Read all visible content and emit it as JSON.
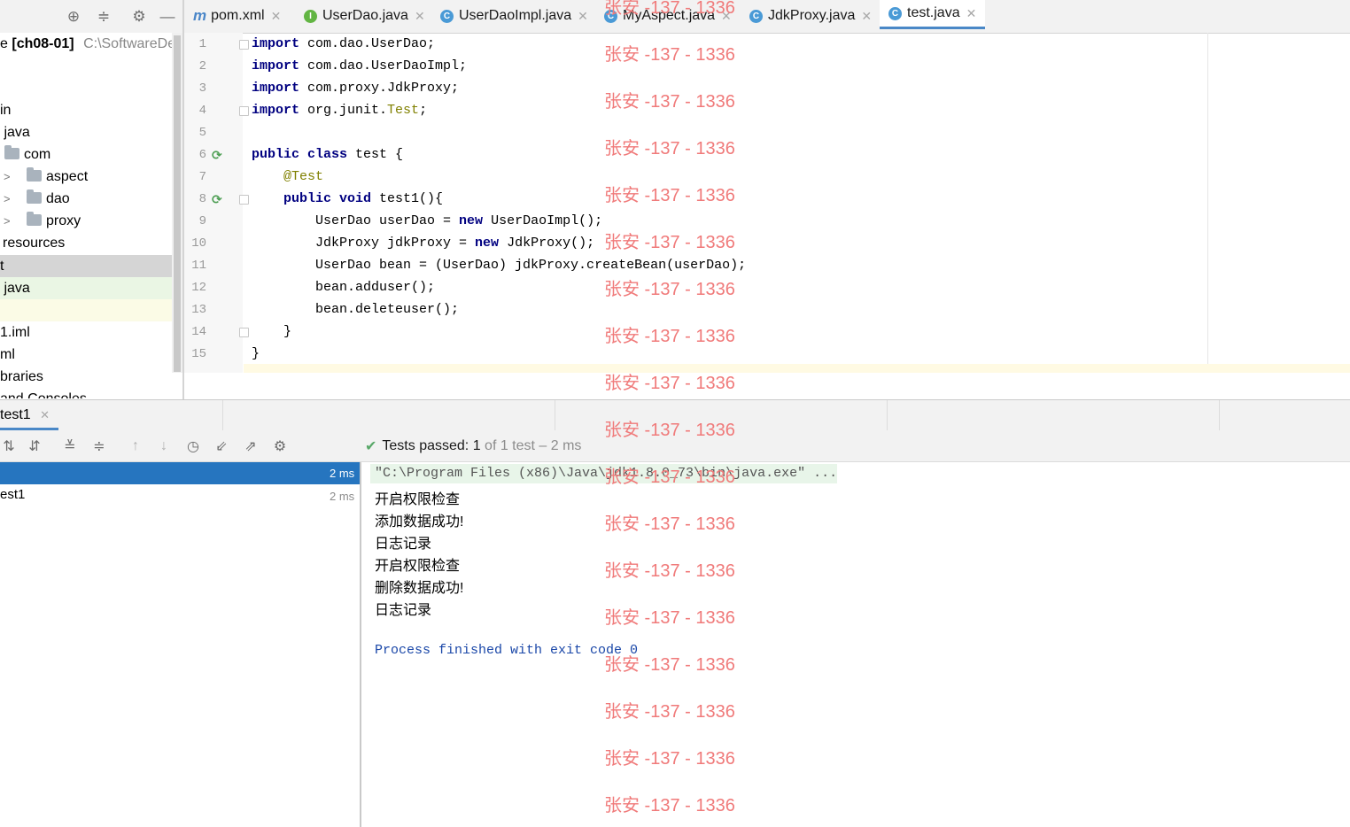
{
  "project_toolbar": {
    "icons": [
      "target-icon",
      "collapse-icon",
      "gear-icon",
      "minimize-icon"
    ]
  },
  "tabs": [
    {
      "label": "pom.xml",
      "icon": "maven-icon",
      "active": false
    },
    {
      "label": "UserDao.java",
      "icon": "interface-icon",
      "active": false
    },
    {
      "label": "UserDaoImpl.java",
      "icon": "class-icon",
      "active": false
    },
    {
      "label": "MyAspect.java",
      "icon": "class-icon",
      "active": false
    },
    {
      "label": "JdkProxy.java",
      "icon": "class-icon",
      "active": false
    },
    {
      "label": "test.java",
      "icon": "test-class-icon",
      "active": true
    }
  ],
  "project_tree": {
    "root_prefix": "e",
    "root_name": "[ch08-01]",
    "root_path": "C:\\SoftwareDep",
    "items": [
      {
        "label": "in"
      },
      {
        "label": "java"
      },
      {
        "label": "com"
      },
      {
        "label": "aspect"
      },
      {
        "label": "dao"
      },
      {
        "label": "proxy"
      },
      {
        "label": "resources"
      },
      {
        "label": "t"
      },
      {
        "label": "java"
      },
      {
        "label": ""
      },
      {
        "label": "1.iml"
      },
      {
        "label": "ml"
      },
      {
        "label": "braries"
      },
      {
        "label": "and Consoles"
      }
    ]
  },
  "editor": {
    "line_numbers": [
      "1",
      "2",
      "3",
      "4",
      "5",
      "6",
      "7",
      "8",
      "9",
      "10",
      "11",
      "12",
      "13",
      "14",
      "15"
    ],
    "lines": [
      [
        "import",
        " com.dao.UserDao;"
      ],
      [
        "import",
        " com.dao.UserDaoImpl;"
      ],
      [
        "import",
        " com.proxy.JdkProxy;"
      ],
      [
        "import",
        " org.junit.",
        "Test",
        ";"
      ],
      [],
      [
        "public class",
        " test {"
      ],
      [
        "    ",
        "@Test"
      ],
      [
        "    ",
        "public void",
        " test1(){"
      ],
      [
        "        UserDao userDao = ",
        "new",
        " UserDaoImpl();"
      ],
      [
        "        JdkProxy jdkProxy = ",
        "new",
        " JdkProxy();"
      ],
      [
        "        UserDao bean = (UserDao) jdkProxy.createBean(userDao);"
      ],
      [
        "        bean.adduser();"
      ],
      [
        "        bean.deleteuser();"
      ],
      [
        "    }"
      ],
      [
        "}"
      ]
    ]
  },
  "run_window": {
    "tab_label": "test1",
    "status_text": "Tests passed:",
    "status_count": "1",
    "status_rest": "of 1 test – 2 ms",
    "tree": [
      {
        "label": "",
        "time": "2 ms",
        "selected": true
      },
      {
        "label": "est1",
        "time": "2 ms",
        "selected": false
      }
    ],
    "toolbar_icons": [
      "sort-alpha-icon",
      "sort-duration-icon",
      "expand-all-icon",
      "collapse-all-icon",
      "up-arrow-icon",
      "down-arrow-icon",
      "history-icon",
      "import-icon",
      "export-icon",
      "gear-icon"
    ]
  },
  "console": {
    "command": "\"C:\\Program Files (x86)\\Java\\jdk1.8.0_73\\bin\\java.exe\" ...",
    "output": [
      "开启权限检查",
      "添加数据成功!",
      "日志记录",
      "开启权限检查",
      "删除数据成功!",
      "日志记录"
    ],
    "finish": "Process finished with exit code 0"
  },
  "watermark": "张安 -137 - 1336",
  "colors": {
    "keyword": "#000080",
    "annotation": "#808000",
    "selection": "#2675bf",
    "pass_green": "#59a869",
    "watermark": "#f07a7a"
  }
}
